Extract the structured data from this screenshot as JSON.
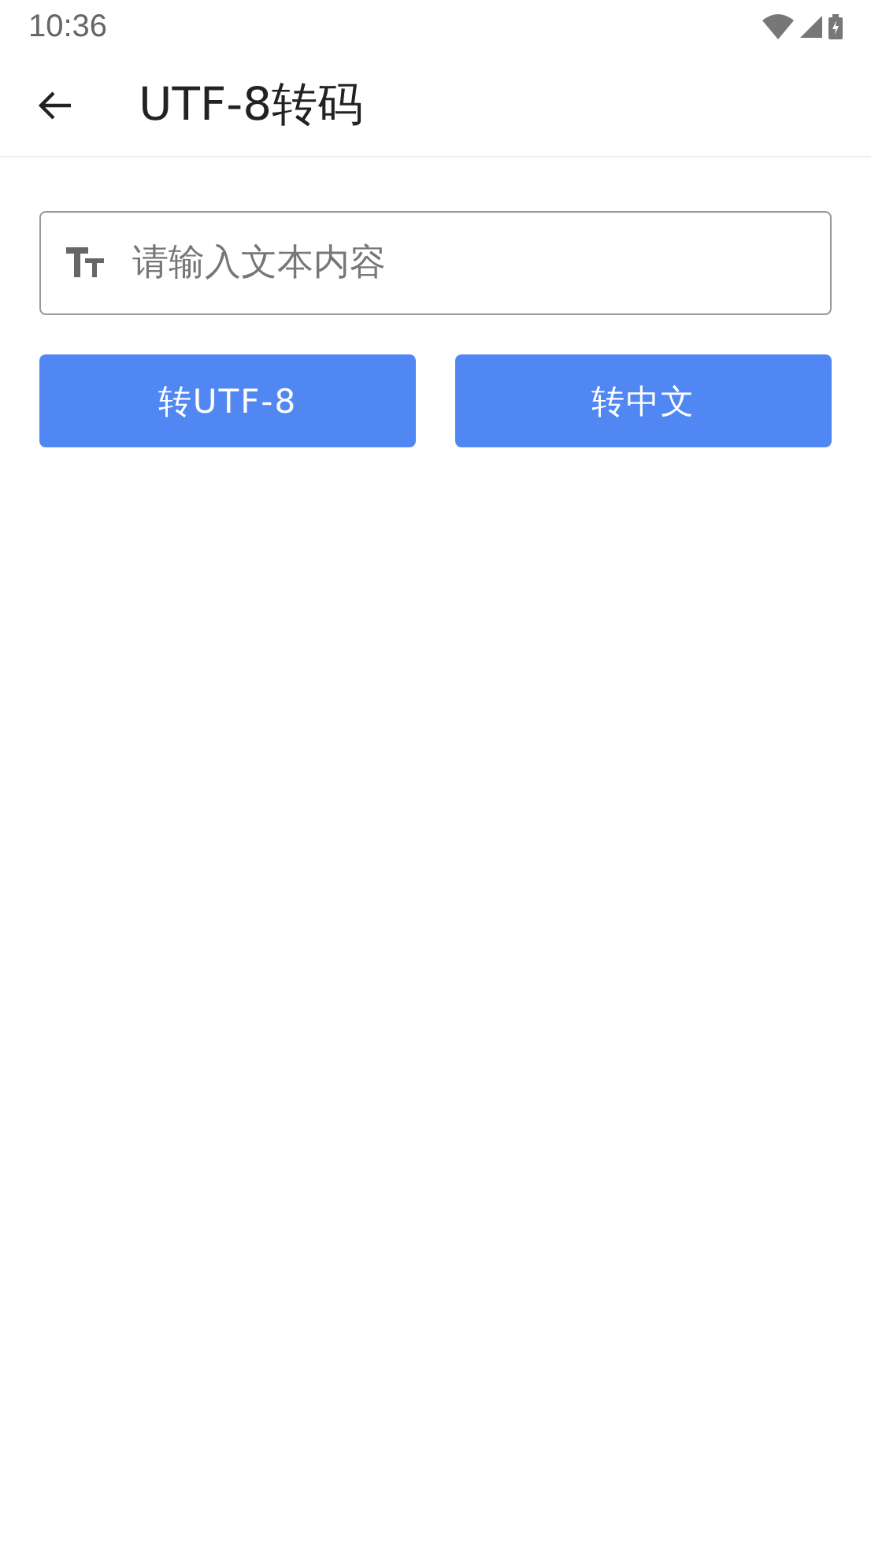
{
  "status_bar": {
    "time": "10:36"
  },
  "app_bar": {
    "title": "UTF-8转码"
  },
  "input": {
    "placeholder": "请输入文本内容"
  },
  "buttons": [
    "转UTF-8",
    "转中文"
  ]
}
